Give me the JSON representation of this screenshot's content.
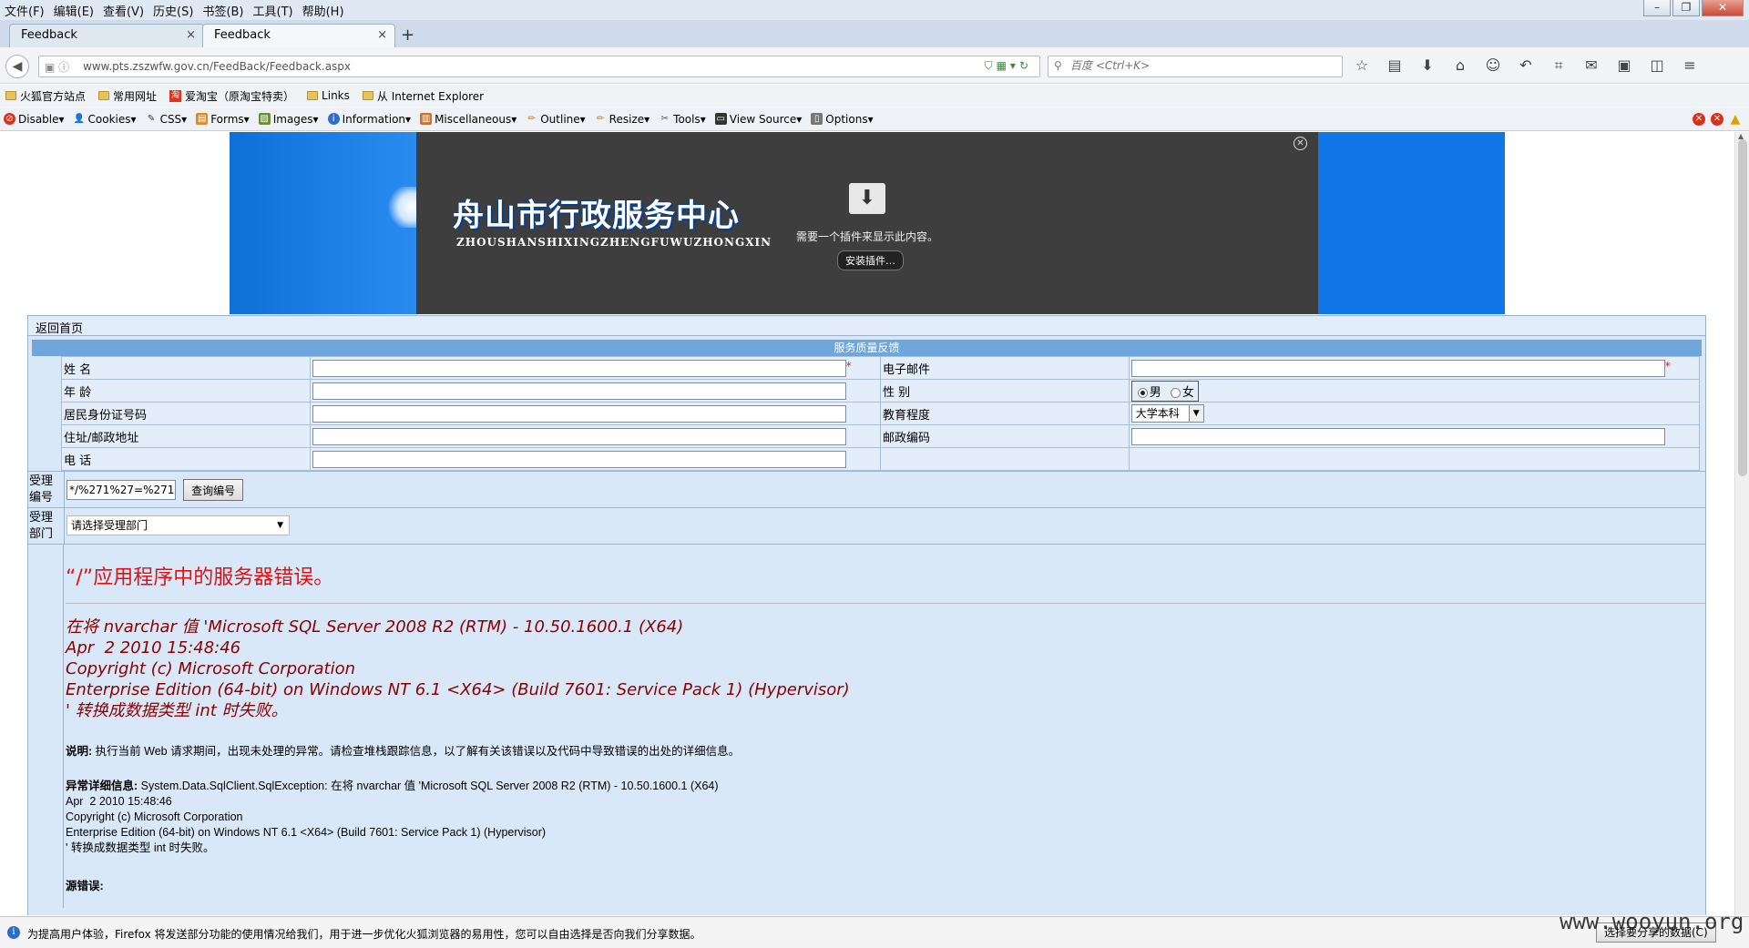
{
  "menu": [
    "文件(F)",
    "编辑(E)",
    "查看(V)",
    "历史(S)",
    "书签(B)",
    "工具(T)",
    "帮助(H)"
  ],
  "tabs": [
    {
      "label": "Feedback",
      "close": "×"
    },
    {
      "label": "Feedback",
      "close": "×"
    }
  ],
  "new_tab": "+",
  "nav": {
    "url": "www.pts.zszwfw.gov.cn/FeedBack/Feedback.aspx",
    "search_placeholder": "百度 <Ctrl+K>"
  },
  "bookmarks": [
    "火狐官方站点",
    "常用网址",
    "爱淘宝（原淘宝特卖）",
    "Links",
    "从 Internet Explorer"
  ],
  "devtoolbar": [
    "Disable▾",
    "Cookies▾",
    "CSS▾",
    "Forms▾",
    "Images▾",
    "Information▾",
    "Miscellaneous▾",
    "Outline▾",
    "Resize▾",
    "Tools▾",
    "View Source▾",
    "Options▾"
  ],
  "banner": {
    "title": "舟山市行政服务中心",
    "subtitle": "ZHOUSHANSHIXINGZHENGFUWUZHONGXIN",
    "plugin_message": "需要一个插件来显示此内容。",
    "plugin_button": "安装插件…"
  },
  "form": {
    "home_link": "返回首页",
    "section_title": "服务质量反馈",
    "labels": {
      "name": "姓 名",
      "email": "电子邮件",
      "age": "年 龄",
      "gender": "性 别",
      "id_card": "居民身份证号码",
      "education": "教育程度",
      "address": "住址/邮政地址",
      "postcode": "邮政编码",
      "phone": "电 话"
    },
    "required_mark": "*",
    "gender_options": [
      "男",
      "女"
    ],
    "education_value": "大学本科",
    "accept_id_label": "受理编号",
    "accept_id_value": "*/%271%27=%271",
    "query_button": "查询编号",
    "dept_label": "受理部门",
    "dept_value": "请选择受理部门"
  },
  "error": {
    "title": "“/”应用程序中的服务器错误。",
    "message": "在将 nvarchar 值 'Microsoft SQL Server 2008 R2 (RTM) - 10.50.1600.1 (X64)\nApr  2 2010 15:48:46\nCopyright (c) Microsoft Corporation\nEnterprise Edition (64-bit) on Windows NT 6.1 <X64> (Build 7601: Service Pack 1) (Hypervisor)\n' 转换成数据类型 int 时失败。",
    "desc_label": "说明:",
    "desc_text": " 执行当前 Web 请求期间，出现未处理的异常。请检查堆栈跟踪信息，以了解有关该错误以及代码中导致错误的出处的详细信息。",
    "detail_label": "异常详细信息:",
    "detail_text": " System.Data.SqlClient.SqlException: 在将 nvarchar 值 'Microsoft SQL Server 2008 R2 (RTM) - 10.50.1600.1 (X64)\nApr  2 2010 15:48:46\nCopyright (c) Microsoft Corporation\nEnterprise Edition (64-bit) on Windows NT 6.1 <X64> (Build 7601: Service Pack 1) (Hypervisor)\n' 转换成数据类型 int 时失败。",
    "source_label": "源错误:"
  },
  "notification": {
    "text": "为提高用户体验，Firefox 将发送部分功能的使用情况给我们，用于进一步优化火狐浏览器的易用性，您可以自由选择是否向我们分享数据。",
    "button": "选择要分享的数据(C)"
  },
  "watermark": "www.wooyun.org"
}
